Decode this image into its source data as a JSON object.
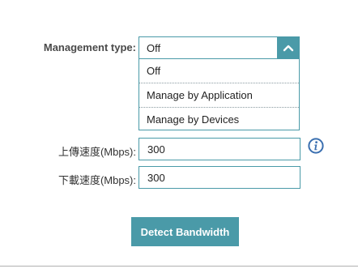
{
  "management": {
    "label": "Management type:",
    "selected": "Off",
    "options": [
      "Off",
      "Manage by Application",
      "Manage by Devices"
    ]
  },
  "upload": {
    "label": "上傳速度(Mbps):",
    "value": "300"
  },
  "download": {
    "label": "下載速度(Mbps):",
    "value": "300"
  },
  "detect_button": {
    "label": "Detect Bandwidth"
  },
  "colors": {
    "accent": "#4a9aa8",
    "info_icon": "#3a6fb0"
  },
  "icons": {
    "select_arrow": "chevron-up-icon",
    "info": "info-icon"
  }
}
